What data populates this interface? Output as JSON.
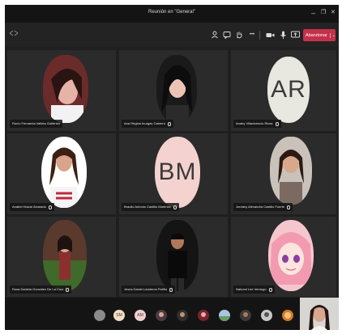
{
  "window": {
    "title": "Reunión en \"General\"",
    "minimize": "–",
    "restore": "❐",
    "close": "✕"
  },
  "toolbar": {
    "leave_label": "Abandonar",
    "more_label": "•••"
  },
  "participants": [
    {
      "name": "Rocío Fernanda Valleta Gutiérrez",
      "initials": ""
    },
    {
      "name": "Ana Regina Inurgas Caberro",
      "initials": ""
    },
    {
      "name": "Anahy Villavicencio Rivas",
      "initials": "AR"
    },
    {
      "name": "Anabel Huizar Alvarado",
      "initials": ""
    },
    {
      "name": "Braulio Antonio Castillo Martínez",
      "initials": "BM"
    },
    {
      "name": "Jordany Alexandra Castillo Fuerte",
      "initials": ""
    },
    {
      "name": "Rosa Daniela González De La Cruz",
      "initials": ""
    },
    {
      "name": "Jesús Daniel Landeros Patiño",
      "initials": ""
    },
    {
      "name": "Nahomi Lee Verdugo",
      "initials": ""
    }
  ],
  "overflow": [
    {
      "initials": ""
    },
    {
      "initials": "SM"
    },
    {
      "initials": "AM"
    }
  ],
  "colors": {
    "leave": "#c4314b",
    "avatar_bg": "#f3d2cf",
    "initials_bg_gray": "#e8e8e0"
  }
}
